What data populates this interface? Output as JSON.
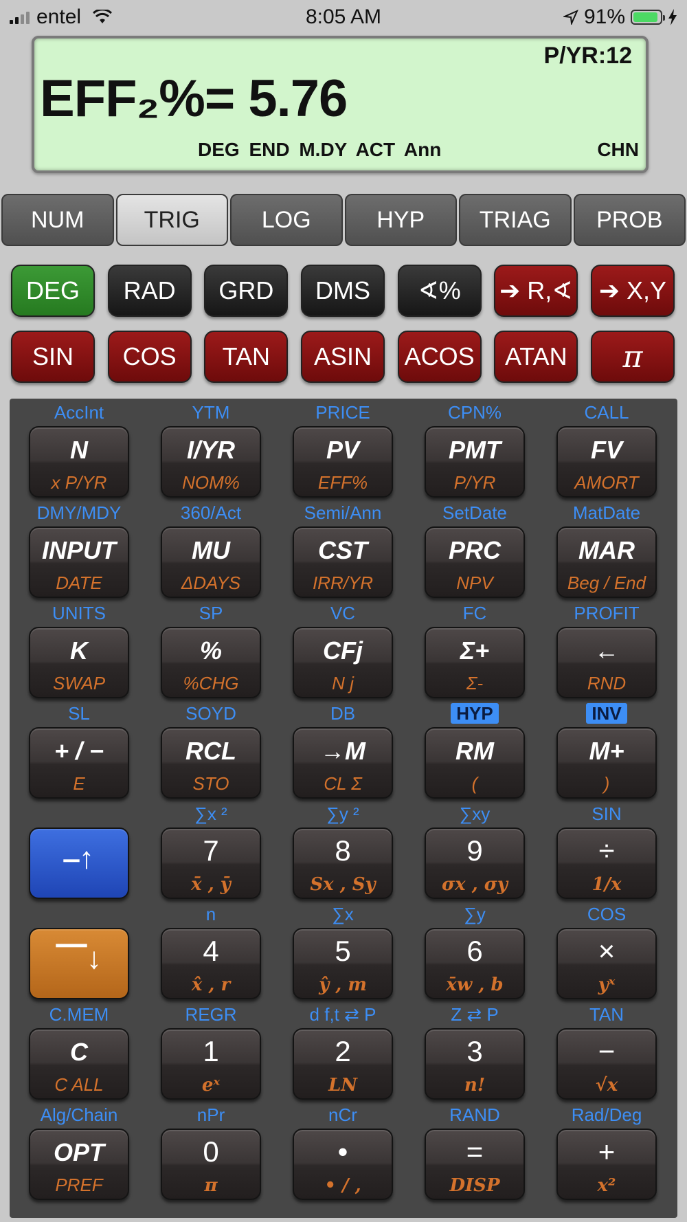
{
  "status": {
    "carrier": "entel",
    "time": "8:05 AM",
    "battery": "91%",
    "battery_level": 0.91
  },
  "display": {
    "pyr": "P/YR:12",
    "main": "EFF₂%= 5.76",
    "indicators": "DEG END M.DY ACT Ann",
    "mode": "CHN"
  },
  "tabs": [
    "NUM",
    "TRIG",
    "LOG",
    "HYP",
    "TRIAG",
    "PROB"
  ],
  "active_tab": "TRIG",
  "trig_row1": [
    "DEG",
    "RAD",
    "GRD",
    "DMS",
    "∢%",
    "➔ R,∢",
    "➔ X,Y"
  ],
  "trig_row2": [
    "SIN",
    "COS",
    "TAN",
    "ASIN",
    "ACOS",
    "ATAN",
    "π"
  ],
  "keys": [
    [
      {
        "top": "AccInt",
        "main": "N",
        "sub": "x P/YR"
      },
      {
        "top": "YTM",
        "main": "I/YR",
        "sub": "NOM%"
      },
      {
        "top": "PRICE",
        "main": "PV",
        "sub": "EFF%"
      },
      {
        "top": "CPN%",
        "main": "PMT",
        "sub": "P/YR"
      },
      {
        "top": "CALL",
        "main": "FV",
        "sub": "AMORT"
      }
    ],
    [
      {
        "top": "DMY/MDY",
        "main": "INPUT",
        "sub": "DATE"
      },
      {
        "top": "360/Act",
        "main": "MU",
        "sub": "ΔDAYS"
      },
      {
        "top": "Semi/Ann",
        "main": "CST",
        "sub": "IRR/YR"
      },
      {
        "top": "SetDate",
        "main": "PRC",
        "sub": "NPV"
      },
      {
        "top": "MatDate",
        "main": "MAR",
        "sub": "Beg / End"
      }
    ],
    [
      {
        "top": "UNITS",
        "main": "K",
        "sub": "SWAP"
      },
      {
        "top": "SP",
        "main": "%",
        "sub": "%CHG"
      },
      {
        "top": "VC",
        "main": "CFj",
        "sub": "N j"
      },
      {
        "top": "FC",
        "main": "Σ+",
        "sub": "Σ-"
      },
      {
        "top": "PROFIT",
        "main": "←",
        "sub": "RND"
      }
    ],
    [
      {
        "top": "SL",
        "main": "+ / −",
        "sub": "E"
      },
      {
        "top": "SOYD",
        "main": "RCL",
        "sub": "STO"
      },
      {
        "top": "DB",
        "main": "→M",
        "sub": "CL Σ"
      },
      {
        "top": "HYP",
        "main": "RM",
        "sub": "("
      },
      {
        "top": "INV",
        "main": "M+",
        "sub": ")"
      }
    ],
    [
      {
        "top": "",
        "main": "",
        "sub": ""
      },
      {
        "top": "∑x ²",
        "main": "7",
        "sub": "x̄ , ȳ"
      },
      {
        "top": "∑y ²",
        "main": "8",
        "sub": "Sx , Sy"
      },
      {
        "top": "∑xy",
        "main": "9",
        "sub": "σx , σy"
      },
      {
        "top": "SIN",
        "main": "÷",
        "sub": "1/x"
      }
    ],
    [
      {
        "top": "",
        "main": "",
        "sub": ""
      },
      {
        "top": "n",
        "main": "4",
        "sub": "x̂ , r"
      },
      {
        "top": "∑x",
        "main": "5",
        "sub": "ŷ , m"
      },
      {
        "top": "∑y",
        "main": "6",
        "sub": "x̄w , b"
      },
      {
        "top": "COS",
        "main": "×",
        "sub": "yˣ"
      }
    ],
    [
      {
        "top": "C.MEM",
        "main": "C",
        "sub": "C ALL"
      },
      {
        "top": "REGR",
        "main": "1",
        "sub": "eˣ"
      },
      {
        "top": "d f,t ⇄ P",
        "main": "2",
        "sub": "LN"
      },
      {
        "top": "Z ⇄ P",
        "main": "3",
        "sub": "n!"
      },
      {
        "top": "TAN",
        "main": "−",
        "sub": "√x"
      }
    ],
    [
      {
        "top": "Alg/Chain",
        "main": "OPT",
        "sub": "PREF"
      },
      {
        "top": "nPr",
        "main": "0",
        "sub": "π"
      },
      {
        "top": "nCr",
        "main": "•",
        "sub": "• / ,"
      },
      {
        "top": "RAND",
        "main": "=",
        "sub": "DISP"
      },
      {
        "top": "Rad/Deg",
        "main": "+",
        "sub": "x²"
      }
    ]
  ],
  "colors": {
    "display_bg": "#d2f5cc",
    "top_label": "#3d8ef5",
    "sub_label": "#d4722c",
    "deg_active": "#2e8a28",
    "trig_red": "#8a1414",
    "shift_up": "#2f5bd0",
    "shift_down": "#c87826"
  }
}
